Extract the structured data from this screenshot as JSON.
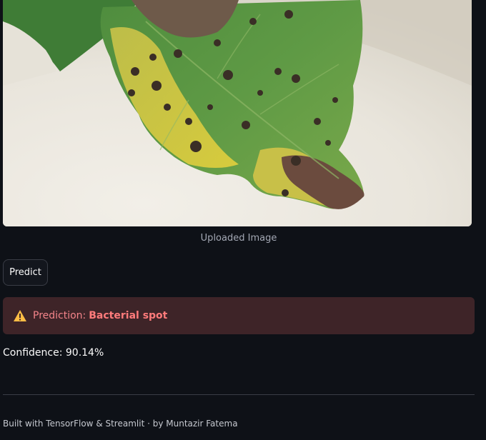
{
  "image": {
    "caption": "Uploaded Image",
    "subject": "tomato-leaf-with-bacterial-spot"
  },
  "actions": {
    "predict_label": "Predict"
  },
  "result": {
    "prediction_label": "Prediction:",
    "prediction_value": "Bacterial spot",
    "confidence_text": "Confidence: 90.14%",
    "alert_icon": "warning-triangle-icon",
    "alert_color": "#3e2428"
  },
  "footer": {
    "text": "Built with TensorFlow & Streamlit · by Muntazir Fatema"
  },
  "theme": {
    "background": "#0e1117",
    "alert_text": "#ff7b7b",
    "warning_icon_color": "#ffbd45"
  }
}
